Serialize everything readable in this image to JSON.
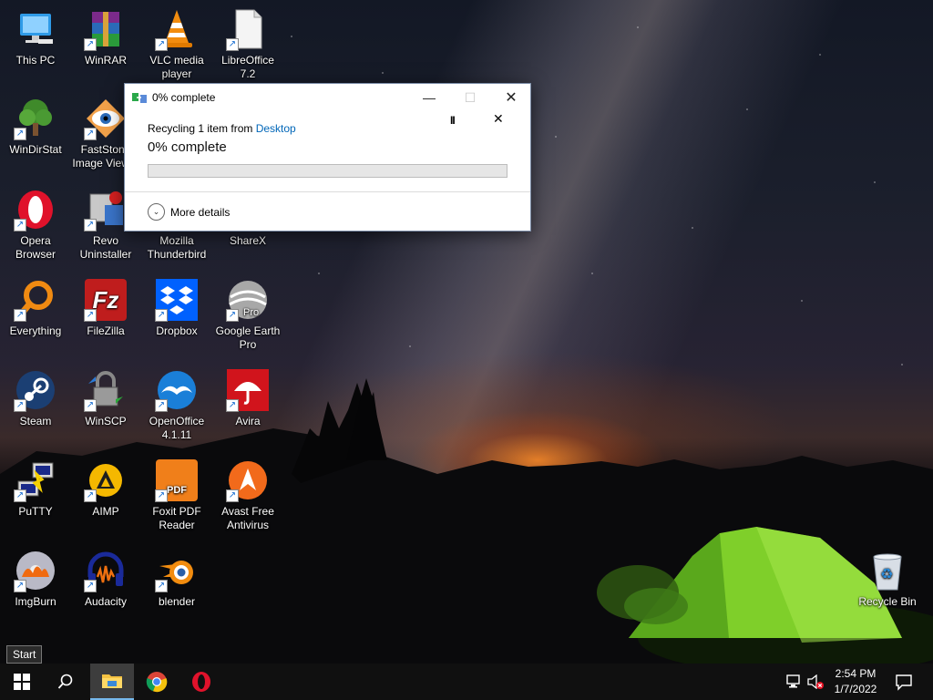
{
  "desktop": {
    "icons": [
      {
        "id": "this-pc",
        "label": "This PC",
        "icon": "monitor-icon"
      },
      {
        "id": "winrar",
        "label": "WinRAR",
        "icon": "archive-books-icon"
      },
      {
        "id": "vlc",
        "label": "VLC media player",
        "icon": "traffic-cone-icon"
      },
      {
        "id": "libreoffice",
        "label": "LibreOffice 7.2",
        "icon": "document-icon"
      },
      {
        "id": "windirstat",
        "label": "WinDirStat",
        "icon": "tree-icon"
      },
      {
        "id": "faststone",
        "label": "FastStone Image Viewer",
        "icon": "eye-icon"
      },
      {
        "id": "opera",
        "label": "Opera Browser",
        "icon": "opera-icon"
      },
      {
        "id": "revo",
        "label": "Revo Uninstaller",
        "icon": "uninstaller-icon"
      },
      {
        "id": "thunderbird",
        "label": "Mozilla Thunderbird",
        "icon": "thunderbird-icon"
      },
      {
        "id": "sharex",
        "label": "ShareX",
        "icon": "sharex-icon"
      },
      {
        "id": "everything",
        "label": "Everything",
        "icon": "magnifier-icon"
      },
      {
        "id": "filezilla",
        "label": "FileZilla",
        "icon": "filezilla-icon"
      },
      {
        "id": "dropbox",
        "label": "Dropbox",
        "icon": "dropbox-icon"
      },
      {
        "id": "google-earth",
        "label": "Google Earth Pro",
        "icon": "globe-icon"
      },
      {
        "id": "steam",
        "label": "Steam",
        "icon": "steam-icon"
      },
      {
        "id": "winscp",
        "label": "WinSCP",
        "icon": "padlock-icon"
      },
      {
        "id": "openoffice",
        "label": "OpenOffice 4.1.11",
        "icon": "seagull-icon"
      },
      {
        "id": "avira",
        "label": "Avira",
        "icon": "umbrella-icon"
      },
      {
        "id": "putty",
        "label": "PuTTY",
        "icon": "terminal-icon"
      },
      {
        "id": "aimp",
        "label": "AIMP",
        "icon": "triangle-icon"
      },
      {
        "id": "foxit",
        "label": "Foxit PDF Reader",
        "icon": "pdf-icon"
      },
      {
        "id": "avast",
        "label": "Avast Free Antivirus",
        "icon": "avast-icon"
      },
      {
        "id": "imgburn",
        "label": "ImgBurn",
        "icon": "disc-flame-icon"
      },
      {
        "id": "audacity",
        "label": "Audacity",
        "icon": "headphones-icon"
      },
      {
        "id": "blender",
        "label": "blender",
        "icon": "blender-icon"
      },
      {
        "id": "recycle-bin",
        "label": "Recycle Bin",
        "icon": "recycle-bin-icon"
      }
    ]
  },
  "dialog": {
    "title": "0% complete",
    "line1_prefix": "Recycling 1 item from ",
    "line1_link": "Desktop",
    "status": "0% complete",
    "progress": 0,
    "more_details": "More details",
    "pause_symbol": "II",
    "cancel_symbol": "✕",
    "minimize_symbol": "—",
    "maximize_symbol": "☐",
    "close_symbol": "✕"
  },
  "tooltip": {
    "text": "Start"
  },
  "taskbar": {
    "pinned": [
      "start-button",
      "search-button",
      "file-explorer",
      "google-chrome",
      "opera"
    ],
    "clock": {
      "time": "2:54 PM",
      "date": "1/7/2022"
    }
  },
  "colors": {
    "accent": "#0066b8",
    "taskbar": "#101010",
    "tent_green": "#7ed321"
  }
}
